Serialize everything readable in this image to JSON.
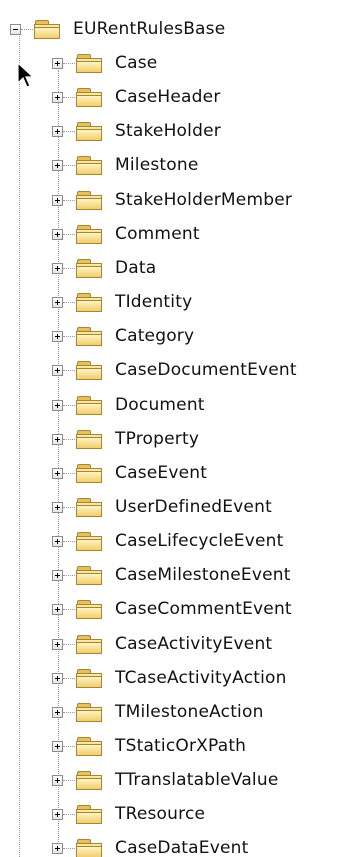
{
  "tree": {
    "root": {
      "label": "EURentRulesBase",
      "expanded": true,
      "icon": "folder-icon"
    },
    "children": [
      {
        "label": "Case"
      },
      {
        "label": "CaseHeader"
      },
      {
        "label": "StakeHolder"
      },
      {
        "label": "Milestone"
      },
      {
        "label": "StakeHolderMember"
      },
      {
        "label": "Comment"
      },
      {
        "label": "Data"
      },
      {
        "label": "TIdentity"
      },
      {
        "label": "Category"
      },
      {
        "label": "CaseDocumentEvent"
      },
      {
        "label": "Document"
      },
      {
        "label": "TProperty"
      },
      {
        "label": "CaseEvent"
      },
      {
        "label": "UserDefinedEvent"
      },
      {
        "label": "CaseLifecycleEvent"
      },
      {
        "label": "CaseMilestoneEvent"
      },
      {
        "label": "CaseCommentEvent"
      },
      {
        "label": "CaseActivityEvent"
      },
      {
        "label": "TCaseActivityAction"
      },
      {
        "label": "TMilestoneAction"
      },
      {
        "label": "TStaticOrXPath"
      },
      {
        "label": "TTranslatableValue"
      },
      {
        "label": "TResource"
      },
      {
        "label": "CaseDataEvent"
      }
    ],
    "colors": {
      "folder_fill": "#eac45f",
      "folder_border": "#a78534",
      "connector": "#9a9a9a"
    }
  }
}
